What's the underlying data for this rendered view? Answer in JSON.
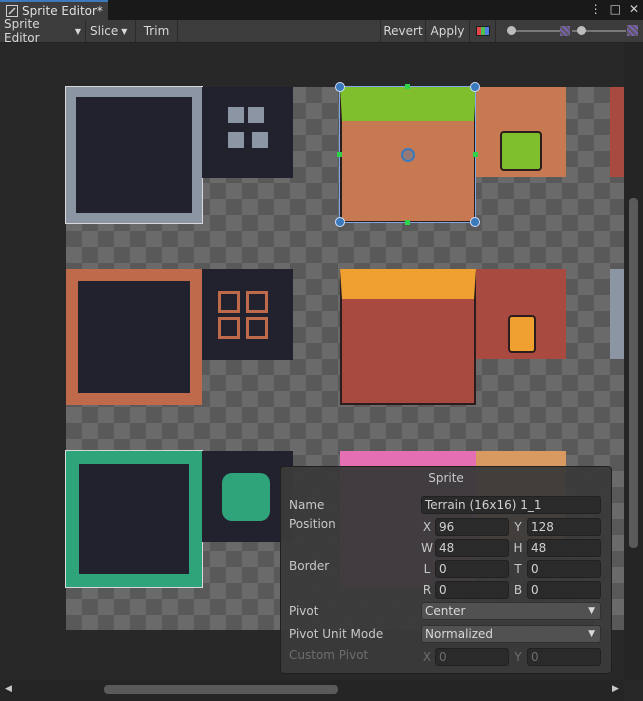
{
  "window": {
    "tab_title": "Sprite Editor*",
    "menu_glyph": "⋮",
    "maximize_glyph": "□",
    "close_glyph": "✕"
  },
  "toolbar": {
    "sprite_editor_label": "Sprite Editor",
    "slice_label": "Slice",
    "trim_label": "Trim",
    "revert_label": "Revert",
    "apply_label": "Apply",
    "zoom_level": 0.12
  },
  "panel": {
    "title": "Sprite",
    "name_label": "Name",
    "name_value": "Terrain (16x16) 1_1",
    "position_label": "Position",
    "x_label": "X",
    "x_value": "96",
    "y_label": "Y",
    "y_value": "128",
    "w_label": "W",
    "w_value": "48",
    "h_label": "H",
    "h_value": "48",
    "border_label": "Border",
    "l_label": "L",
    "l_value": "0",
    "t_label": "T",
    "t_value": "0",
    "r_label": "R",
    "r_value": "0",
    "b_label": "B",
    "b_value": "0",
    "pivot_label": "Pivot",
    "pivot_value": "Center",
    "pivot_unit_mode_label": "Pivot Unit Mode",
    "pivot_unit_mode_value": "Normalized",
    "custom_pivot_label": "Custom Pivot",
    "cp_x_label": "X",
    "cp_x_value": "0",
    "cp_y_label": "Y",
    "cp_y_value": "0"
  },
  "colors": {
    "accent": "#3a79bb",
    "grass": "#7fbf2e",
    "dirt": "#c77a52",
    "orange": "#f0a030",
    "clay": "#a84a3f",
    "stone": "#8c95a3",
    "teal": "#2fa37a",
    "pink": "#e56fb3"
  }
}
